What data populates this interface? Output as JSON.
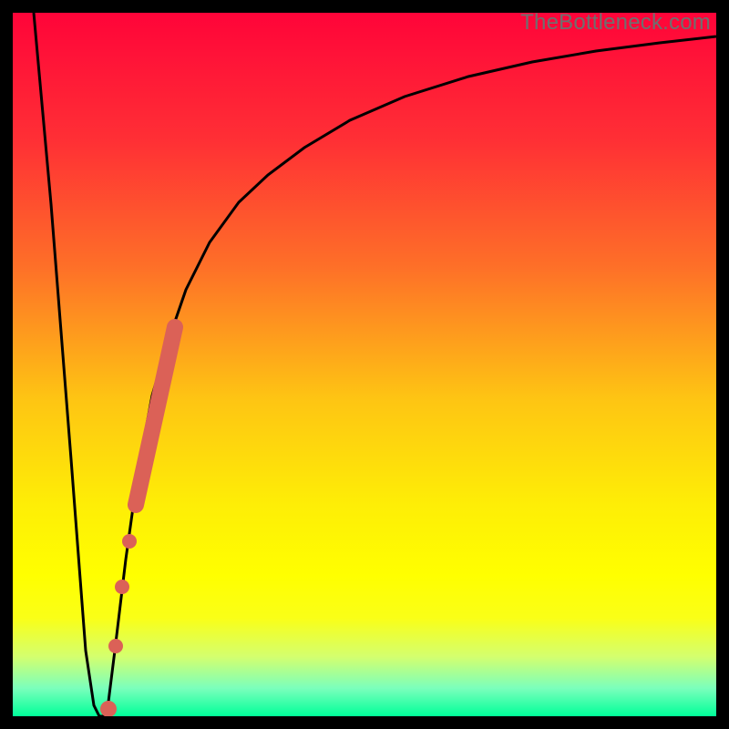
{
  "watermark": "TheBottleneck.com",
  "chart_data": {
    "type": "line",
    "title": "",
    "xlabel": "",
    "ylabel": "",
    "xlim": [
      0,
      100
    ],
    "ylim": [
      0,
      100
    ],
    "grid": false,
    "series": [
      {
        "name": "curve",
        "x": [
          3,
          5,
          8,
          10,
          11.5,
          12.5,
          13.5,
          15,
          17,
          19,
          21,
          24,
          27,
          30,
          34,
          38,
          43,
          50,
          58,
          66,
          74,
          82,
          90,
          100
        ],
        "y": [
          100,
          70,
          30,
          6,
          0,
          0,
          8,
          20,
          34,
          45,
          53,
          62,
          69,
          74,
          79,
          83,
          86.5,
          89.5,
          92,
          93.6,
          94.8,
          95.6,
          96.2,
          97
        ]
      }
    ],
    "markers": {
      "name": "highlight-band",
      "description": "coral dotted/rounded marker segment along rising curve",
      "color": "#db6157",
      "x_range": [
        15,
        23
      ],
      "y_range": [
        1,
        58
      ]
    },
    "background_gradient": {
      "type": "vertical",
      "stops": [
        {
          "pos": 0.0,
          "color": "#ff0439"
        },
        {
          "pos": 0.18,
          "color": "#ff2f35"
        },
        {
          "pos": 0.36,
          "color": "#fe6f28"
        },
        {
          "pos": 0.55,
          "color": "#fec513"
        },
        {
          "pos": 0.7,
          "color": "#feee06"
        },
        {
          "pos": 0.8,
          "color": "#ffff00"
        },
        {
          "pos": 0.86,
          "color": "#faff17"
        },
        {
          "pos": 0.915,
          "color": "#d4ff6e"
        },
        {
          "pos": 0.96,
          "color": "#7bffbc"
        },
        {
          "pos": 1.0,
          "color": "#00ff99"
        }
      ]
    }
  }
}
